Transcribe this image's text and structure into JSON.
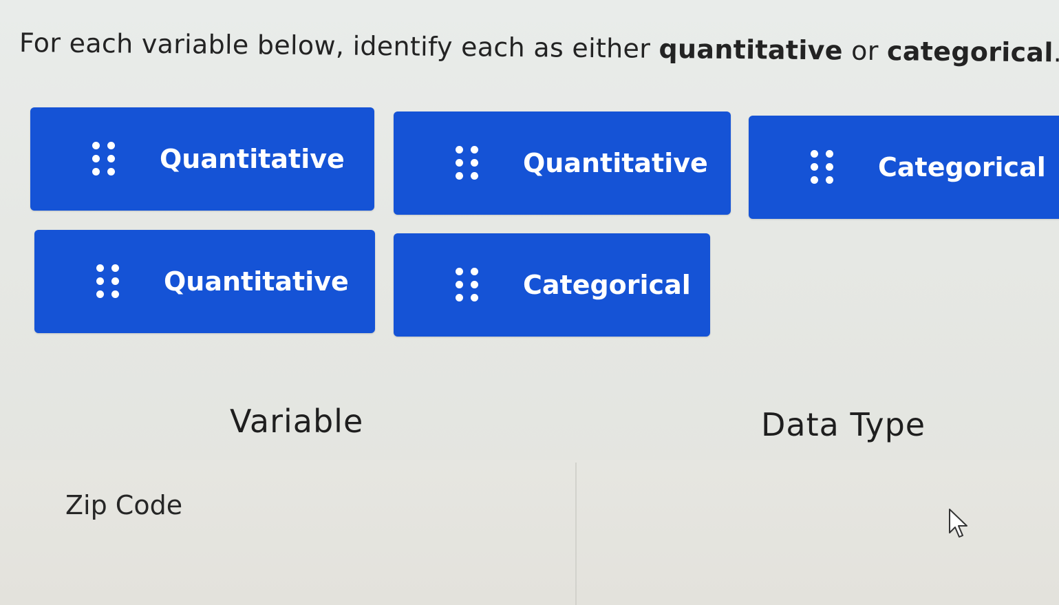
{
  "prompt": {
    "lead": "For each variable below, identify each as either ",
    "term1": "quantitative",
    "middle": " or ",
    "term2": "categorical",
    "end": "."
  },
  "answer_bank": [
    {
      "label": "Quantitative"
    },
    {
      "label": "Quantitative"
    },
    {
      "label": "Categorical"
    },
    {
      "label": "Quantitative"
    },
    {
      "label": "Categorical"
    }
  ],
  "table": {
    "headers": {
      "variable": "Variable",
      "data_type": "Data Type"
    },
    "rows": [
      {
        "variable": "Zip Code",
        "data_type": ""
      }
    ]
  },
  "icons": {
    "chip_handle": "drag-handle-icon",
    "pointer": "mouse-cursor-icon"
  },
  "colors": {
    "chip_background": "#1553d6",
    "chip_text": "#ffffff",
    "page_background": "#e8eae7"
  }
}
